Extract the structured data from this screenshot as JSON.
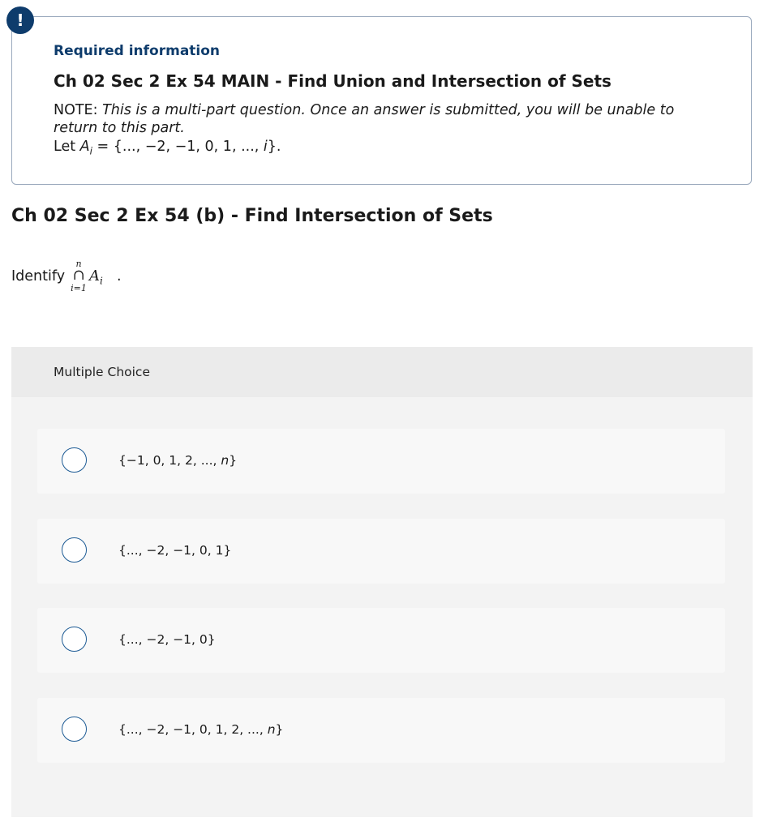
{
  "required_info": {
    "badge_glyph": "!",
    "label": "Required information",
    "title": "Ch 02 Sec 2 Ex 54 MAIN - Find Union and Intersection of Sets",
    "note_prefix": "NOTE: ",
    "note_text": "This is a multi-part question. Once an answer is submitted, you will be unable to return to this part.",
    "let_prefix": "Let ",
    "let_set_name": "A",
    "let_set_index": "i",
    "let_equals": " = {..., −2, −1, 0, 1, ..., ",
    "let_last": "i",
    "let_suffix": "}."
  },
  "question": {
    "title": "Ch 02 Sec 2 Ex 54 (b) - Find Intersection of Sets",
    "prompt_text": "Identify",
    "operator_upper": "n",
    "operator_symbol": "∩",
    "operator_lower": "i=1",
    "term_name": "A",
    "term_index": "i",
    "prompt_end": "."
  },
  "multiple_choice": {
    "header": "Multiple Choice",
    "options": [
      {
        "prefix": "{−1, 0, 1, 2, ..., ",
        "var": "n",
        "suffix": "}"
      },
      {
        "prefix": "{..., −2, −1, 0, 1}",
        "var": "",
        "suffix": ""
      },
      {
        "prefix": "{..., −2, −1, 0}",
        "var": "",
        "suffix": ""
      },
      {
        "prefix": "{..., −2, −1, 0, 1, 2, ..., ",
        "var": "n",
        "suffix": "}"
      }
    ]
  },
  "colors": {
    "accent": "#0e3c6c",
    "radio_border": "#1c5a94",
    "panel_bg": "#f0f0f0"
  }
}
